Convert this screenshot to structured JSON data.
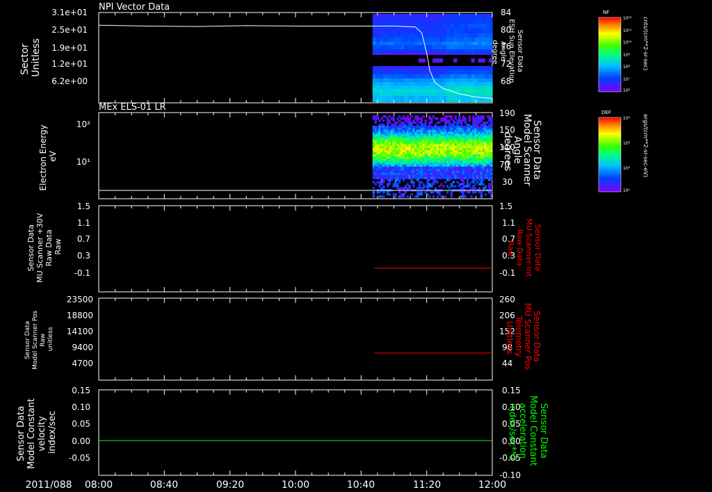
{
  "time_axis": {
    "date": "2011/088",
    "ticks": [
      "08:00",
      "08:40",
      "09:20",
      "10:00",
      "10:40",
      "11:20",
      "12:00"
    ]
  },
  "panels": [
    {
      "title": "NPI Vector Data",
      "left_label": [
        "Sector",
        "Unitless"
      ],
      "left_ticks": [
        "3.1e+01",
        "2.5e+01",
        "1.9e+01",
        "1.2e+01",
        "6.2e+00"
      ],
      "right_label": [
        "Sensor Data",
        "ESH Sun Elevation",
        "Angle",
        "degree"
      ],
      "right_ticks": [
        "84",
        "80",
        "76",
        "72",
        "68"
      ],
      "colorbar": {
        "name": "NF",
        "ticks": [
          "10¹²",
          "10¹¹",
          "10¹⁰",
          "10⁹",
          "10⁸",
          "10⁷",
          "10⁶"
        ],
        "units": "cnts/(cm**2-sr-sec)"
      }
    },
    {
      "title": "MEx ELS-01 LR",
      "left_label": [
        "Electron Energy",
        "eV"
      ],
      "left_ticks": [
        "10²",
        "10¹"
      ],
      "right_label": [
        "Sensor Data",
        "Model Scanner",
        "Angle",
        "degrees"
      ],
      "right_ticks": [
        "190",
        "150",
        "110",
        "70",
        "30"
      ],
      "colorbar": {
        "name": "DEF",
        "ticks": [
          "10⁴",
          "10³",
          "10²",
          "10¹"
        ],
        "units": "ergs/(cm**2-sr-sec-eV)"
      }
    },
    {
      "title": "",
      "left_label": [
        "Sensor Data",
        "MU Scanner +30V",
        "Raw Data",
        "Raw"
      ],
      "left_ticks": [
        "1.5",
        "1.1",
        "0.7",
        "0.3",
        "-0.1"
      ],
      "right_label": [
        "Sensor Data",
        "MU Scanner Int",
        "Raw Data",
        "Raw"
      ],
      "right_ticks": [
        "1.5",
        "1.1",
        "0.7",
        "0.3",
        "-0.1"
      ]
    },
    {
      "title": "",
      "left_label": [
        "Sensor Data",
        "Model Scanner Pos",
        "Raw",
        "unitless"
      ],
      "left_ticks": [
        "23500",
        "18800",
        "14100",
        "9400",
        "4700"
      ],
      "right_label": [
        "Sensor Data",
        "MU Scanner Pos",
        "Telemetry",
        "Unitless"
      ],
      "right_ticks": [
        "260",
        "206",
        "152",
        "98",
        "44"
      ]
    },
    {
      "title": "",
      "left_label": [
        "Sensor Data",
        "Model Constant",
        "velocity",
        "index/sec"
      ],
      "left_ticks": [
        "0.15",
        "0.10",
        "0.05",
        "0.00",
        "-0.05",
        "-0.10"
      ],
      "right_label": [
        "Sensor Data",
        "Model Constant",
        "acceleration",
        "index/sec**2"
      ],
      "right_ticks": [
        "0.15",
        "0.10",
        "0.05",
        "0.00",
        "-0.05",
        "-0.10"
      ]
    }
  ],
  "chart_data": [
    {
      "type": "line",
      "panel": "NPI Vector Data",
      "x_range": [
        "08:00",
        "12:00"
      ],
      "y_range_right": [
        64,
        84
      ],
      "spectrogram_start": "10:47",
      "series": [
        {
          "color": "#ffffff",
          "x": [
            "08:00",
            "08:30",
            "09:00",
            "09:30",
            "10:00",
            "10:47",
            "11:00",
            "11:13",
            "11:17",
            "11:20",
            "11:22",
            "11:25",
            "11:30",
            "11:40",
            "11:50",
            "12:00"
          ],
          "values": [
            81.2,
            81.0,
            80.9,
            81.1,
            81.0,
            81.0,
            81.0,
            80.8,
            79.5,
            75.0,
            71.0,
            68.5,
            67.2,
            66.0,
            65.3,
            65.0
          ]
        }
      ]
    },
    {
      "type": "heatmap",
      "panel": "MEx ELS-01 LR",
      "x_range": [
        "08:00",
        "12:00"
      ],
      "data_start": "10:47",
      "y_scale": "log",
      "line_level_eV": 2
    },
    {
      "type": "line",
      "panel": "MU Scanner +30V",
      "x_range": [
        "08:00",
        "12:00"
      ],
      "y_range": [
        -0.3,
        1.5
      ],
      "series": [
        {
          "color": "#ff0000",
          "x": [
            "10:46",
            "12:00"
          ],
          "values": [
            0.0,
            0.0
          ]
        }
      ]
    },
    {
      "type": "line",
      "panel": "MU Scanner Pos",
      "x_range": [
        "08:00",
        "12:00"
      ],
      "y_range_right": [
        0,
        260
      ],
      "series": [
        {
          "color": "#ff0000",
          "x": [
            "10:46",
            "12:00"
          ],
          "values": [
            116,
            116
          ]
        }
      ]
    },
    {
      "type": "line",
      "panel": "Model Constant",
      "x_range": [
        "08:00",
        "12:00"
      ],
      "y_range": [
        -0.1,
        0.15
      ],
      "series": [
        {
          "color": "#00ff00",
          "x": [
            "08:00",
            "12:00"
          ],
          "values": [
            0.0,
            0.0
          ]
        }
      ]
    }
  ],
  "colors": {
    "axis": "#ffffff",
    "red_label": "#ff0000",
    "green_label": "#00ff00"
  }
}
